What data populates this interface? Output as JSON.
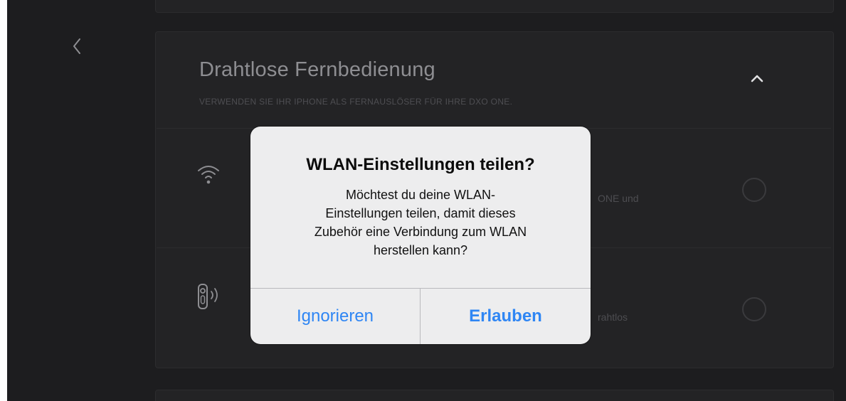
{
  "section": {
    "title": "Drahtlose Fernbedienung",
    "subtitle": "VERWENDEN SIE IHR IPHONE ALS FERNAUSLÖSER FÜR IHRE DXO ONE."
  },
  "options": [
    {
      "icon": "wifi-icon",
      "text_fragment": "ONE und",
      "selected": false
    },
    {
      "icon": "remote-icon",
      "text_fragment": "rahtlos",
      "selected": false
    }
  ],
  "dialog": {
    "title": "WLAN-Einstellungen teilen?",
    "message": "Möchtest du deine WLAN-\nEinstellungen teilen, damit dieses\nZubehör eine Verbindung zum WLAN\nherstellen kann?",
    "cancel_label": "Ignorieren",
    "confirm_label": "Erlauben"
  },
  "colors": {
    "background": "#1d1d1f",
    "panel": "#232325",
    "dialog_background": "#ededee",
    "accent": "#2f86f4"
  }
}
